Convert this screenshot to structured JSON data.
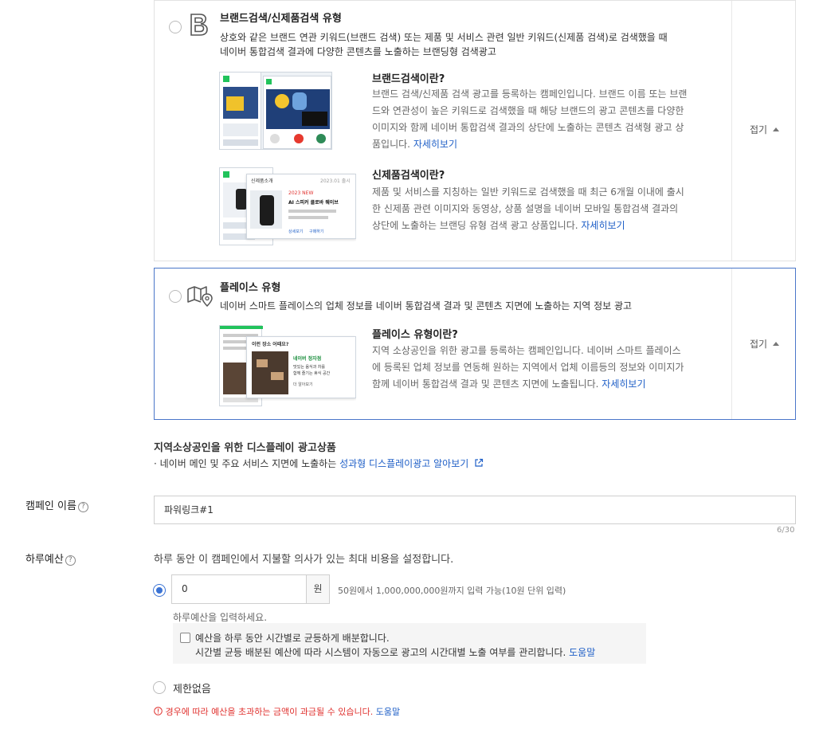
{
  "brand_card": {
    "title": "브랜드검색/신제품검색 유형",
    "desc_line1": "상호와 같은 브랜드 연관 키워드(브랜드 검색) 또는 제품 및 서비스 관련 일반 키워드(신제품 검색)로 검색했을 때",
    "desc_line2": "네이버 통합검색 결과에 다양한 콘텐츠를 노출하는 브랜딩형 검색광고",
    "collapse_label": "접기",
    "brand_sub_title": "브랜드검색이란?",
    "brand_sub_lines": [
      "브랜드 검색/신제품 검색 광고를 등록하는 캠페인입니다. 브랜드 이름 또는 브랜",
      "드와 연관성이 높은 키워드로 검색했을 때 해당 브랜드의 광고 콘텐츠를 다양한",
      "이미지와 함께 네이버 통합검색 결과의 상단에 노출하는 콘텐츠 검색형 광고 상",
      "품입니다."
    ],
    "newprod_sub_title": "신제품검색이란?",
    "newprod_sub_lines": [
      "제품 및 서비스를 지칭하는 일반 키워드로 검색했을 때 최근 6개월 이내에 출시",
      "한 신제품 관련 이미지와 동영상, 상품 설명을 네이버 모바일 통합검색 결과의",
      "상단에 노출하는 브랜딩 유형 검색 광고 상품입니다."
    ],
    "more_link": "자세히보기",
    "thumb": {
      "newprod_header": "신제품소개",
      "newprod_date": "2023.01 출시",
      "newprod_badge": "2023 NEW",
      "newprod_name": "AI 스피커 클로바 웨이브",
      "newprod_tag1": "상세보기",
      "newprod_tag2": "구매하기"
    }
  },
  "place_card": {
    "title": "플레이스 유형",
    "desc": "네이버 스마트 플레이스의 업체 정보를 네이버 통합검색 결과 및 콘텐츠 지면에 노출하는 지역 정보 광고",
    "collapse_label": "접기",
    "sub_title": "플레이스 유형이란?",
    "sub_lines": [
      "지역 소상공인을 위한 광고를 등록하는 캠페인입니다. 네이버 스마트 플레이스",
      "에 등록된 업체 정보를 연동해 원하는 지역에서 업체 이름등의 정보와 이미지가",
      "함께 네이버 통합검색 결과 및 콘텐츠 지면에 노출됩니다."
    ],
    "more_link": "자세히보기",
    "thumb": {
      "header": "이런 장소 어때요?",
      "name": "네이버 정자점",
      "line1": "맛있는 음식과 차를",
      "line2": "함께 즐기는 휴식 공간",
      "more": "더 알아보기"
    }
  },
  "display_section": {
    "title": "지역소상공인을 위한 디스플레이 광고상품",
    "bullet_text": "· 네이버 메인 및 주요 서비스 지면에 노출하는",
    "link_text": "성과형 디스플레이광고 알아보기"
  },
  "campaign_name": {
    "label": "캠페인 이름",
    "value": "파워링크#1",
    "counter": "6/30"
  },
  "daily_budget": {
    "label": "하루예산",
    "description": "하루 동안 이 캠페인에서 지불할 의사가 있는 최대 비용을 설정합니다.",
    "amount_value": "0",
    "unit": "원",
    "range_hint": "50원에서 1,000,000,000원까지 입력 가능(10원 단위 입력)",
    "prompt": "하루예산을 입력하세요.",
    "distribute_label": "예산을 하루 동안 시간별로 균등하게 배분합니다.",
    "distribute_desc": "시간별 균등 배분된 예산에 따라 시스템이 자동으로 광고의 시간대별 노출 여부를 관리합니다.",
    "help_link": "도움말",
    "unlimited_label": "제한없음",
    "warning": "경우에 따라 예산을 초과하는 금액이 과금될 수 있습니다.",
    "warning_link": "도움말"
  },
  "colors": {
    "accent": "#3b73d4",
    "link": "#1f5fc7",
    "warning": "#e0322f",
    "selected_border": "#4a76c9"
  }
}
